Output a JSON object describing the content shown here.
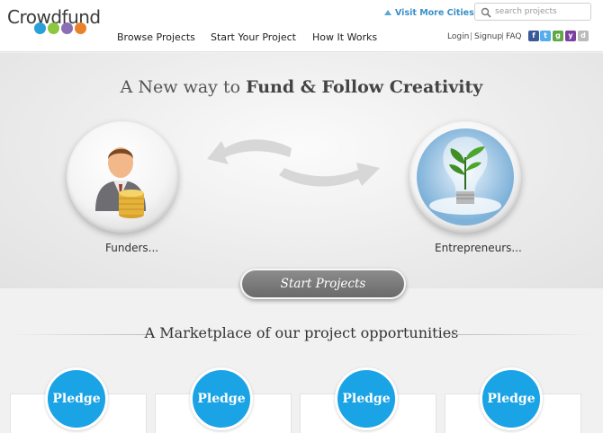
{
  "header": {
    "logo_text": "Crowdfund",
    "logo_dot_colors": [
      "#2ba0d8",
      "#8dc63f",
      "#8a6fb5",
      "#e8822a"
    ],
    "nav": [
      "Browse Projects",
      "Start Your Project",
      "How It Works"
    ],
    "visit_cities": "Visit More Cities",
    "search_placeholder": "search projects",
    "login": "Login",
    "signup": "Signup",
    "faq": "FAQ",
    "separator": "|",
    "social_icons": [
      {
        "name": "facebook-icon",
        "color": "#3b5998",
        "glyph": "f"
      },
      {
        "name": "twitter-icon",
        "color": "#55acee",
        "glyph": "t"
      },
      {
        "name": "google-plus-icon",
        "color": "#5fa844",
        "glyph": "g"
      },
      {
        "name": "yahoo-icon",
        "color": "#7b3fa0",
        "glyph": "y"
      },
      {
        "name": "delicious-icon",
        "color": "#bbbbbb",
        "glyph": "d"
      }
    ]
  },
  "hero": {
    "tagline_plain": "A New way to ",
    "tagline_bold": "Fund & Follow Creativity",
    "funders_label": "Funders...",
    "entrepreneurs_label": "Entrepreneurs...",
    "start_button": "Start Projects"
  },
  "marketplace": {
    "title": "A Marketplace of our project opportunities",
    "pledge_label": "Pledge",
    "accent_color": "#1aa3e5"
  }
}
